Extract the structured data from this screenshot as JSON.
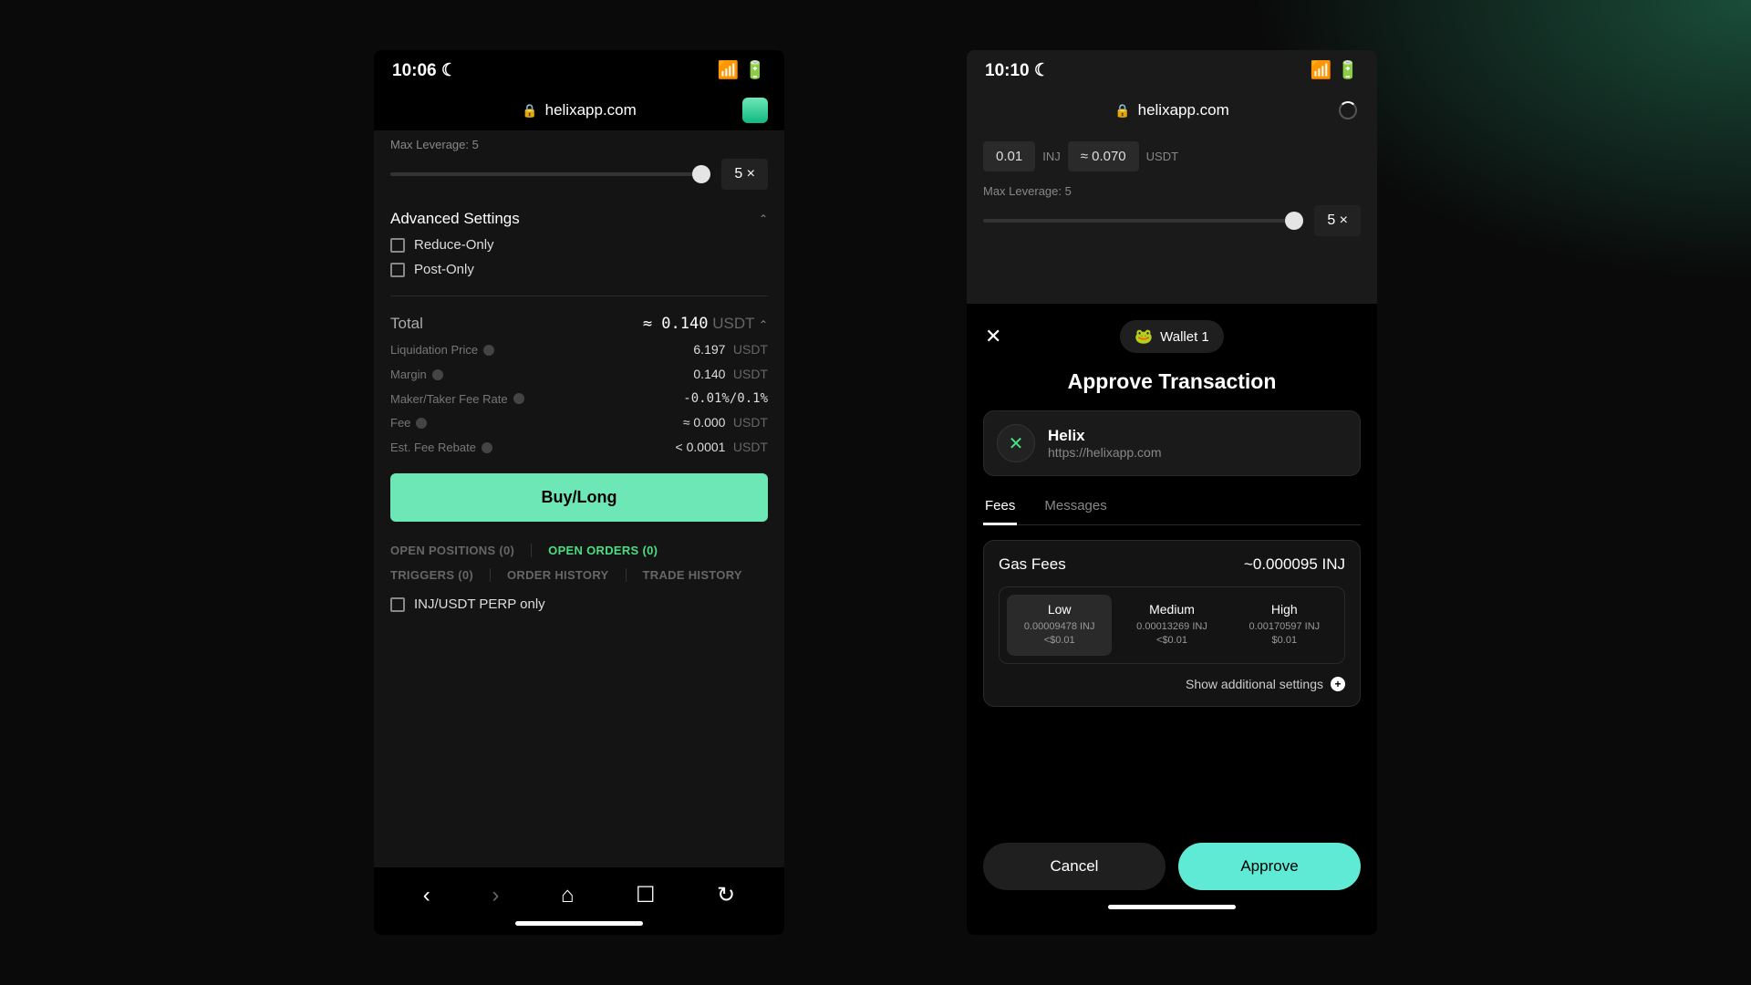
{
  "phone1": {
    "time": "10:06",
    "url": "helixapp.com",
    "maxLeverageLabel": "Max Leverage: 5",
    "leverageValue": "5 ×",
    "advancedTitle": "Advanced Settings",
    "reduceOnly": "Reduce-Only",
    "postOnly": "Post-Only",
    "totalLabel": "Total",
    "totalValue": "≈ 0.140",
    "totalUnit": "USDT",
    "details": [
      {
        "label": "Liquidation Price",
        "value": "6.197",
        "unit": "USDT"
      },
      {
        "label": "Margin",
        "value": "0.140",
        "unit": "USDT"
      },
      {
        "label": "Maker/Taker Fee Rate",
        "value": "-0.01%/0.1%",
        "unit": ""
      },
      {
        "label": "Fee",
        "value": "≈ 0.000",
        "unit": "USDT"
      },
      {
        "label": "Est. Fee Rebate",
        "value": "< 0.0001",
        "unit": "USDT"
      }
    ],
    "buyLabel": "Buy/Long",
    "tabs": [
      "OPEN POSITIONS (0)",
      "OPEN ORDERS (0)",
      "TRIGGERS (0)",
      "ORDER HISTORY",
      "TRADE HISTORY"
    ],
    "perpOnly": "INJ/USDT PERP only"
  },
  "phone2": {
    "time": "10:10",
    "url": "helixapp.com",
    "topRow": {
      "amount": "0.01",
      "token": "INJ",
      "approx": "≈ 0.070",
      "token2": "USDT"
    },
    "maxLeverageLabel": "Max Leverage: 5",
    "leverageValue": "5 ×",
    "walletName": "Wallet 1",
    "modalTitle": "Approve Transaction",
    "appName": "Helix",
    "appUrl": "https://helixapp.com",
    "wtabs": [
      "Fees",
      "Messages"
    ],
    "gasLabel": "Gas Fees",
    "gasValue": "~0.000095 INJ",
    "feeOptions": [
      {
        "tier": "Low",
        "amount": "0.00009478 INJ",
        "usd": "<$0.01"
      },
      {
        "tier": "Medium",
        "amount": "0.00013269 INJ",
        "usd": "<$0.01"
      },
      {
        "tier": "High",
        "amount": "0.00170597 INJ",
        "usd": "$0.01"
      }
    ],
    "showMore": "Show additional settings",
    "cancelLabel": "Cancel",
    "approveLabel": "Approve"
  }
}
